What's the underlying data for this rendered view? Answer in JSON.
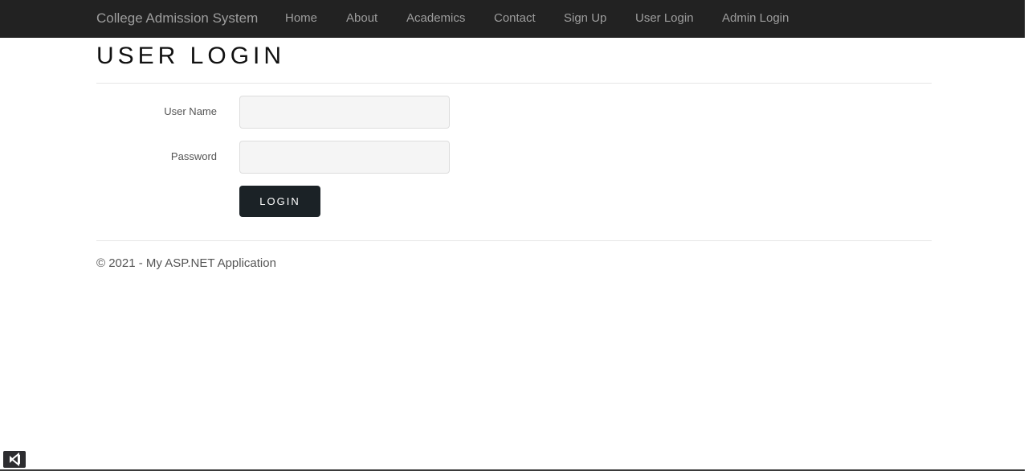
{
  "navbar": {
    "brand": "College Admission System",
    "links": [
      {
        "label": "Home"
      },
      {
        "label": "About"
      },
      {
        "label": "Academics"
      },
      {
        "label": "Contact"
      },
      {
        "label": "Sign Up"
      },
      {
        "label": "User Login"
      },
      {
        "label": "Admin Login"
      }
    ]
  },
  "main": {
    "title": "USER LOGIN",
    "form": {
      "username_label": "User Name",
      "username_value": "",
      "password_label": "Password",
      "password_value": "",
      "login_label": "LOGIN"
    }
  },
  "footer": {
    "text": "© 2021 - My ASP.NET Application"
  },
  "taskbar": {
    "icon": "visual-studio-icon"
  },
  "colors": {
    "navbar_bg": "#222222",
    "nav_text": "#9d9d9d",
    "button_bg": "#1b2226",
    "input_bg": "#f5f5f5"
  }
}
